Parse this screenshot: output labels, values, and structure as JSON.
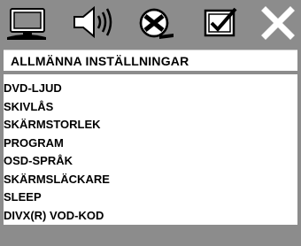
{
  "icons": [
    {
      "name": "general-setup-icon",
      "selected": true
    },
    {
      "name": "audio-setup-icon",
      "selected": false
    },
    {
      "name": "video-setup-icon",
      "selected": false
    },
    {
      "name": "preferences-icon",
      "selected": false
    },
    {
      "name": "exit-icon",
      "selected": false
    }
  ],
  "page": {
    "title": "ALLMÄNNA INSTÄLLNINGAR"
  },
  "menu": {
    "items": [
      {
        "label": "DVD-LJUD"
      },
      {
        "label": "SKIVLÅS"
      },
      {
        "label": "SKÄRMSTORLEK"
      },
      {
        "label": "PROGRAM"
      },
      {
        "label": "OSD-SPRÅK"
      },
      {
        "label": "SKÄRMSLÄCKARE"
      },
      {
        "label": "SLEEP"
      },
      {
        "label": "DIVX(R) VOD-KOD"
      }
    ]
  },
  "colors": {
    "background": "#8c8c8c",
    "panel": "#ffffff",
    "text": "#000000",
    "icon_light": "#ffffff",
    "icon_dark": "#000000"
  }
}
